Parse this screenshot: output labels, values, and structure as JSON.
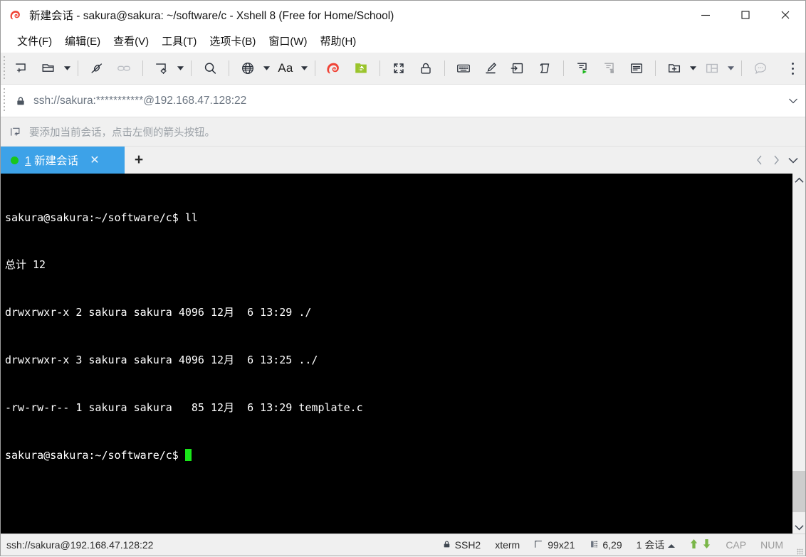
{
  "window": {
    "title": "新建会话 - sakura@sakura: ~/software/c - Xshell 8 (Free for Home/School)",
    "minimize_label": "最小化",
    "maximize_label": "最大化",
    "close_label": "关闭"
  },
  "menubar": {
    "items": [
      {
        "label": "文件(F)",
        "name": "menu-file"
      },
      {
        "label": "编辑(E)",
        "name": "menu-edit"
      },
      {
        "label": "查看(V)",
        "name": "menu-view"
      },
      {
        "label": "工具(T)",
        "name": "menu-tools"
      },
      {
        "label": "选项卡(B)",
        "name": "menu-tabs"
      },
      {
        "label": "窗口(W)",
        "name": "menu-window"
      },
      {
        "label": "帮助(H)",
        "name": "menu-help"
      }
    ]
  },
  "toolbar": {
    "font_button_label": "Aa",
    "icons": [
      "new-session-icon",
      "open-session-icon",
      "disconnect-icon",
      "link-icon",
      "session-properties-icon",
      "search-icon",
      "globe-icon",
      "font-icon",
      "xshell-logo-icon",
      "xftp-icon",
      "fullscreen-icon",
      "lock-icon",
      "keyboard-icon",
      "highlight-pen-icon",
      "log-session-icon",
      "scroll-icon",
      "run-script-icon",
      "stop-script-icon",
      "script-list-icon",
      "new-tab-icon",
      "split-layout-icon",
      "chat-icon",
      "overflow-menu-icon"
    ]
  },
  "address_bar": {
    "url": "ssh://sakura:***********@192.168.47.128:22"
  },
  "hint_bar": {
    "text": "要添加当前会话，点击左侧的箭头按钮。"
  },
  "tabbar": {
    "active_tab_index": "1",
    "active_tab_name": "新建会话",
    "close_label": "✕",
    "new_tab_label": "+"
  },
  "terminal": {
    "lines": [
      "sakura@sakura:~/software/c$ ll",
      "总计 12",
      "drwxrwxr-x 2 sakura sakura 4096 12月  6 13:29 ./",
      "drwxrwxr-x 3 sakura sakura 4096 12月  6 13:25 ../",
      "-rw-rw-r-- 1 sakura sakura   85 12月  6 13:29 template.c"
    ],
    "prompt": "sakura@sakura:~/software/c$ ",
    "background": "#000000",
    "foreground": "#ffffff",
    "cursor_color": "#19e619"
  },
  "statusbar": {
    "url": "ssh://sakura@192.168.47.128:22",
    "protocol": "SSH2",
    "terminal_type": "xterm",
    "size": "99x21",
    "cursor_position": "6,29",
    "sessions": "1 会话",
    "cap": "CAP",
    "num": "NUM"
  }
}
